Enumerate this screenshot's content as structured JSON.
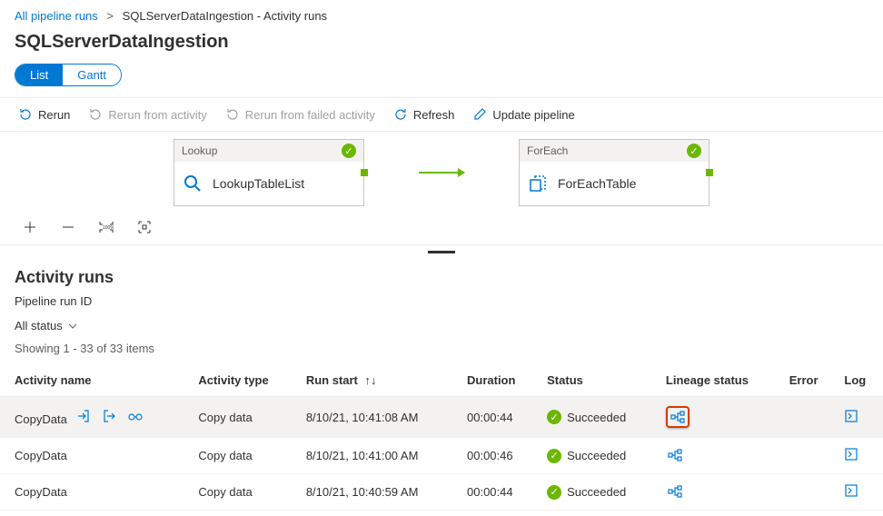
{
  "breadcrumb": {
    "root": "All pipeline runs",
    "current": "SQLServerDataIngestion - Activity runs"
  },
  "page_title": "SQLServerDataIngestion",
  "view_toggle": {
    "list": "List",
    "gantt": "Gantt"
  },
  "toolbar": {
    "rerun": "Rerun",
    "rerun_activity": "Rerun from activity",
    "rerun_failed": "Rerun from failed activity",
    "refresh": "Refresh",
    "update_pipeline": "Update pipeline"
  },
  "nodes": {
    "lookup": {
      "type": "Lookup",
      "name": "LookupTableList"
    },
    "foreach": {
      "type": "ForEach",
      "name": "ForEachTable"
    }
  },
  "section": {
    "title": "Activity runs",
    "pipeline_run_id": "Pipeline run ID",
    "status_filter": "All status",
    "showing": "Showing 1 - 33 of 33 items"
  },
  "columns": {
    "activity_name": "Activity name",
    "activity_type": "Activity type",
    "run_start": "Run start",
    "duration": "Duration",
    "status": "Status",
    "lineage_status": "Lineage status",
    "error": "Error",
    "log": "Log"
  },
  "rows": [
    {
      "name": "CopyData",
      "type": "Copy data",
      "start": "8/10/21, 10:41:08 AM",
      "duration": "00:00:44",
      "status": "Succeeded",
      "highlight": true
    },
    {
      "name": "CopyData",
      "type": "Copy data",
      "start": "8/10/21, 10:41:00 AM",
      "duration": "00:00:46",
      "status": "Succeeded",
      "highlight": false
    },
    {
      "name": "CopyData",
      "type": "Copy data",
      "start": "8/10/21, 10:40:59 AM",
      "duration": "00:00:44",
      "status": "Succeeded",
      "highlight": false
    }
  ]
}
